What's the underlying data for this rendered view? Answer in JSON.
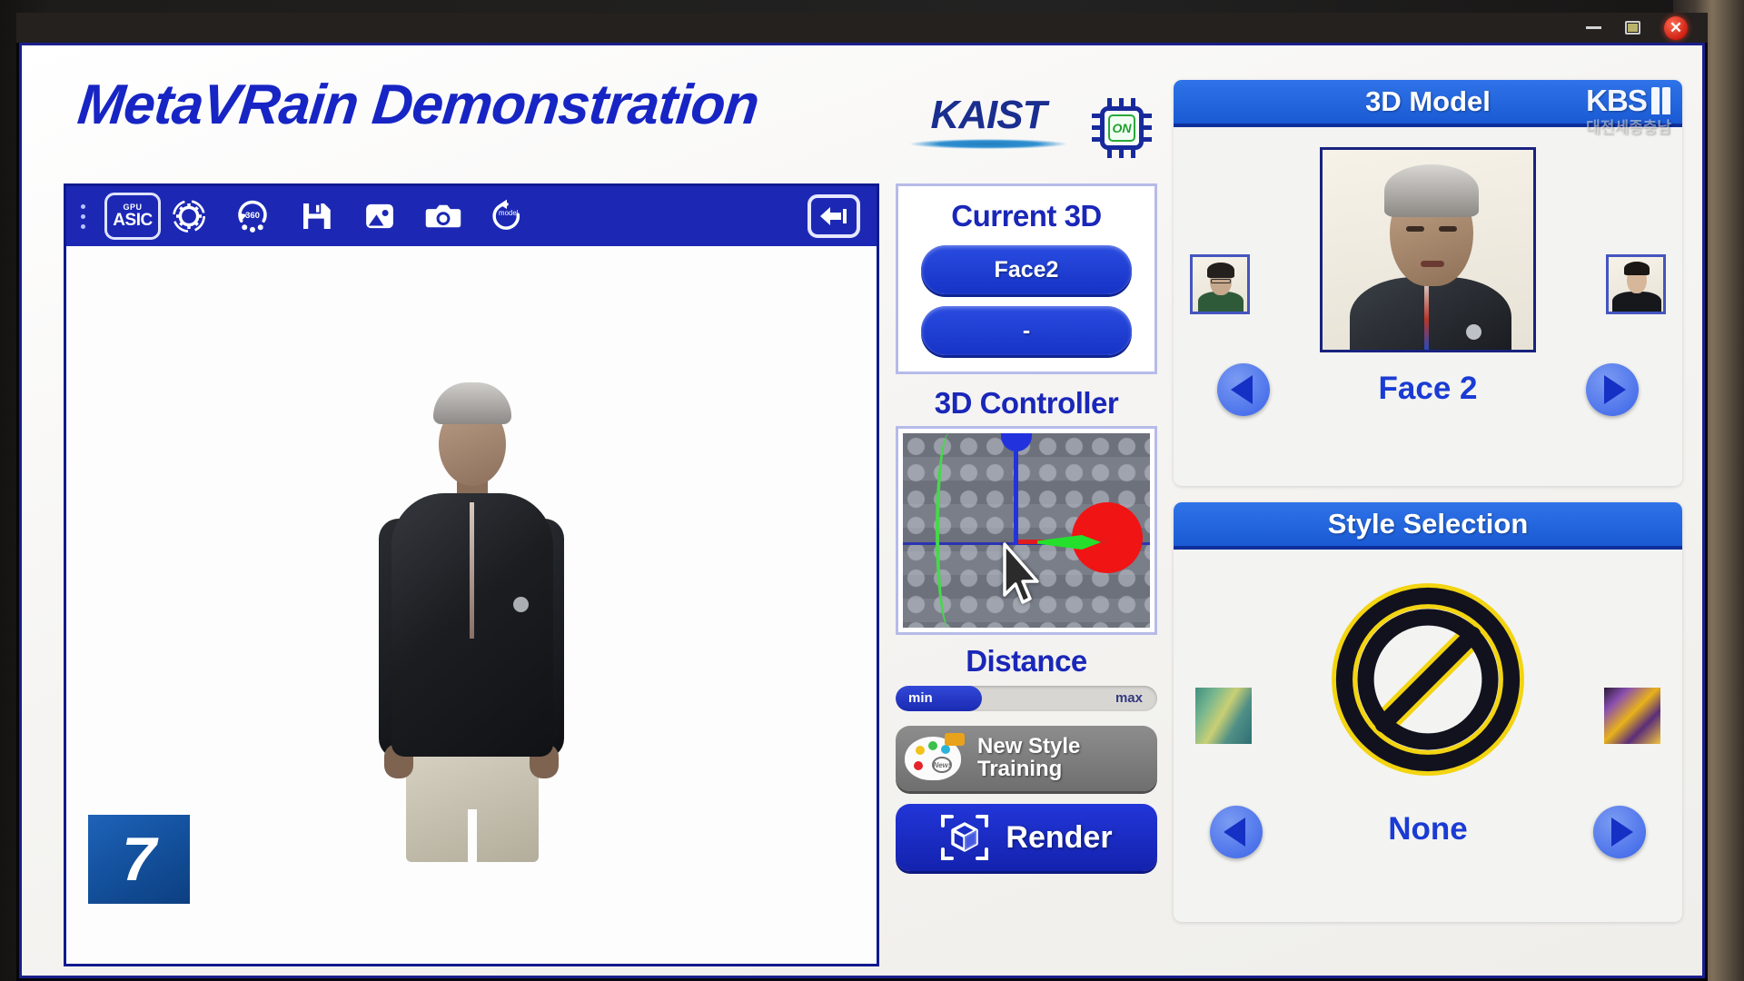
{
  "window": {
    "minimize_label": "—",
    "maximize_label": "□",
    "close_label": "✕"
  },
  "header": {
    "title": "MetaVRain Demonstration",
    "org_logo_text": "KAIST",
    "chip_status": "ON"
  },
  "toolbar": {
    "menu_icon": "kebab-menu-icon",
    "asic_top_label": "GPU",
    "asic_label": "ASIC",
    "settings_icon": "gear-icon",
    "rotate_icon": "360-rotate-icon",
    "save_icon": "floppy-save-icon",
    "image_icon": "image-icon",
    "camera_icon": "camera-icon",
    "model_reset_icon": "model-reset-icon",
    "back_icon": "back-arrow-icon"
  },
  "viewer": {
    "slide_number": "7",
    "render_subject": "3d-avatar-full-body"
  },
  "current_3d": {
    "title": "Current 3D",
    "slot_1": "Face2",
    "slot_2": "-"
  },
  "controller": {
    "title": "3D Controller",
    "axis_colors": {
      "x": "#e01b1b",
      "y": "#2233dd",
      "z": "#24e02c"
    },
    "cursor_icon": "pointer-cursor-icon"
  },
  "distance": {
    "title": "Distance",
    "min_label": "min",
    "max_label": "max",
    "fill_percent": 33
  },
  "actions": {
    "new_style_training": "New Style\nTraining",
    "new_style_training_line1": "New Style",
    "new_style_training_line2": "Training",
    "new_badge": "New!",
    "render": "Render",
    "render_icon": "cube-scan-icon",
    "palette_icon": "palette-icon"
  },
  "model_panel": {
    "title": "3D Model",
    "watermark_text": "KBS",
    "watermark_channel": "1",
    "watermark_sub": "대전세종충남",
    "selected_label": "Face 2",
    "prev_icon": "arrow-left-icon",
    "next_icon": "arrow-right-icon",
    "thumbs": [
      {
        "name": "face-1-thumbnail",
        "alt": "person in green shirt with glasses"
      },
      {
        "name": "face-3-thumbnail",
        "alt": "person in black jacket"
      }
    ]
  },
  "style_panel": {
    "title": "Style Selection",
    "selected_label": "None",
    "none_icon": "no-style-prohibition-icon",
    "prev_icon": "arrow-left-icon",
    "next_icon": "arrow-right-icon",
    "thumbs": [
      {
        "name": "style-thumbnail-left",
        "alt": "impressionist green painting"
      },
      {
        "name": "style-thumbnail-right",
        "alt": "purple and yellow swirl painting"
      }
    ]
  },
  "colors": {
    "brand_blue": "#1c28b4",
    "accent_blue": "#1a5ad4",
    "title_blue": "#1725c4",
    "panel_bg": "#f3f3f1",
    "close_red": "#c9180c",
    "chip_green": "#1f9e2e"
  }
}
